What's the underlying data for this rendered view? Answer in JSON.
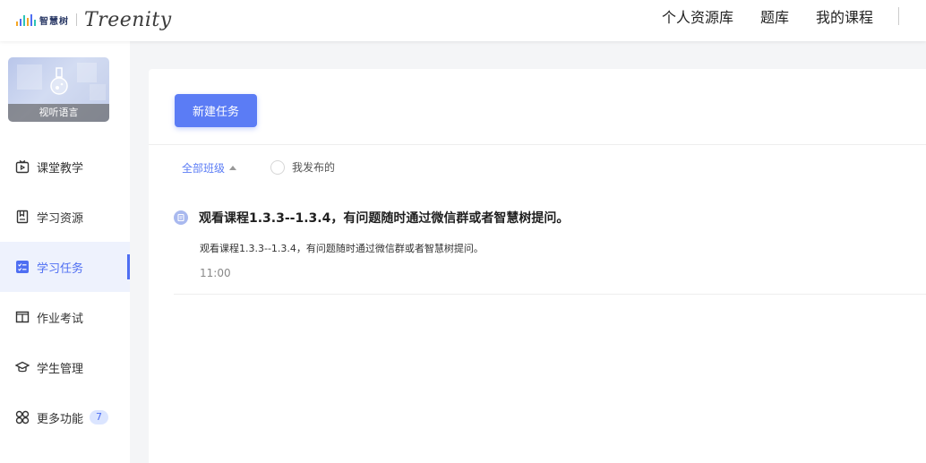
{
  "header": {
    "logo_cn": "智慧树",
    "logo_en": "Treenity",
    "nav": [
      "个人资源库",
      "题库",
      "我的课程"
    ]
  },
  "sidebar": {
    "course_name": "视听语言",
    "items": [
      {
        "label": "课堂教学",
        "icon": "tv-icon"
      },
      {
        "label": "学习资源",
        "icon": "bookmark-icon"
      },
      {
        "label": "学习任务",
        "icon": "task-list-icon",
        "active": true
      },
      {
        "label": "作业考试",
        "icon": "book-icon"
      },
      {
        "label": "学生管理",
        "icon": "graduation-cap-icon"
      },
      {
        "label": "更多功能",
        "icon": "grid-icon",
        "badge": "7"
      }
    ]
  },
  "main": {
    "new_button": "新建任务",
    "filter": {
      "class_label": "全部班级",
      "mine_label": "我发布的"
    },
    "tasks": [
      {
        "title": "观看课程1.3.3--1.3.4，有问题随时通过微信群或者智慧树提问。",
        "description": "观看课程1.3.3--1.3.4，有问题随时通过微信群或者智慧树提问。",
        "time": "11:00"
      }
    ]
  },
  "colors": {
    "accent": "#5b7cf5",
    "active_bg": "#eef2fd",
    "page_bg": "#f4f5f7"
  }
}
